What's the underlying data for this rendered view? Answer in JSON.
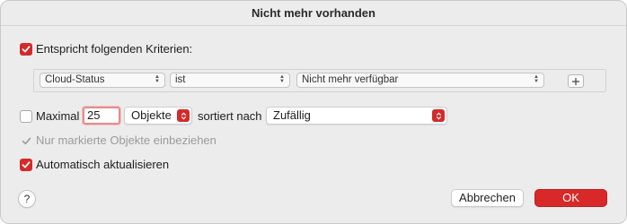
{
  "dialog": {
    "title": "Nicht mehr vorhanden",
    "backdrop_text": "ʻʼ ˈˈ ʻ ʻʻʼ ʻʼʼʻʻ ʻʼʻ"
  },
  "criteria": {
    "match_checkbox": {
      "checked": true,
      "label": "Entspricht folgenden Kriterien:"
    },
    "rule": {
      "field": "Cloud-Status",
      "operator": "ist",
      "value": "Nicht mehr verfügbar"
    },
    "add_button_label": "+"
  },
  "limit": {
    "checkbox": {
      "checked": false,
      "label": "Maximal"
    },
    "amount": "25",
    "unit": "Objekte",
    "sorted_by_label": "sortiert nach",
    "sort_order": "Zufällig"
  },
  "only_checked": {
    "checked": true,
    "enabled": false,
    "label": "Nur markierte Objekte einbeziehen"
  },
  "live_update": {
    "checked": true,
    "label": "Automatisch aktualisieren"
  },
  "footer": {
    "help_label": "?",
    "cancel_label": "Abbrechen",
    "ok_label": "OK"
  },
  "colors": {
    "accent": "#d42a2a",
    "dialog_bg": "#ececec"
  }
}
